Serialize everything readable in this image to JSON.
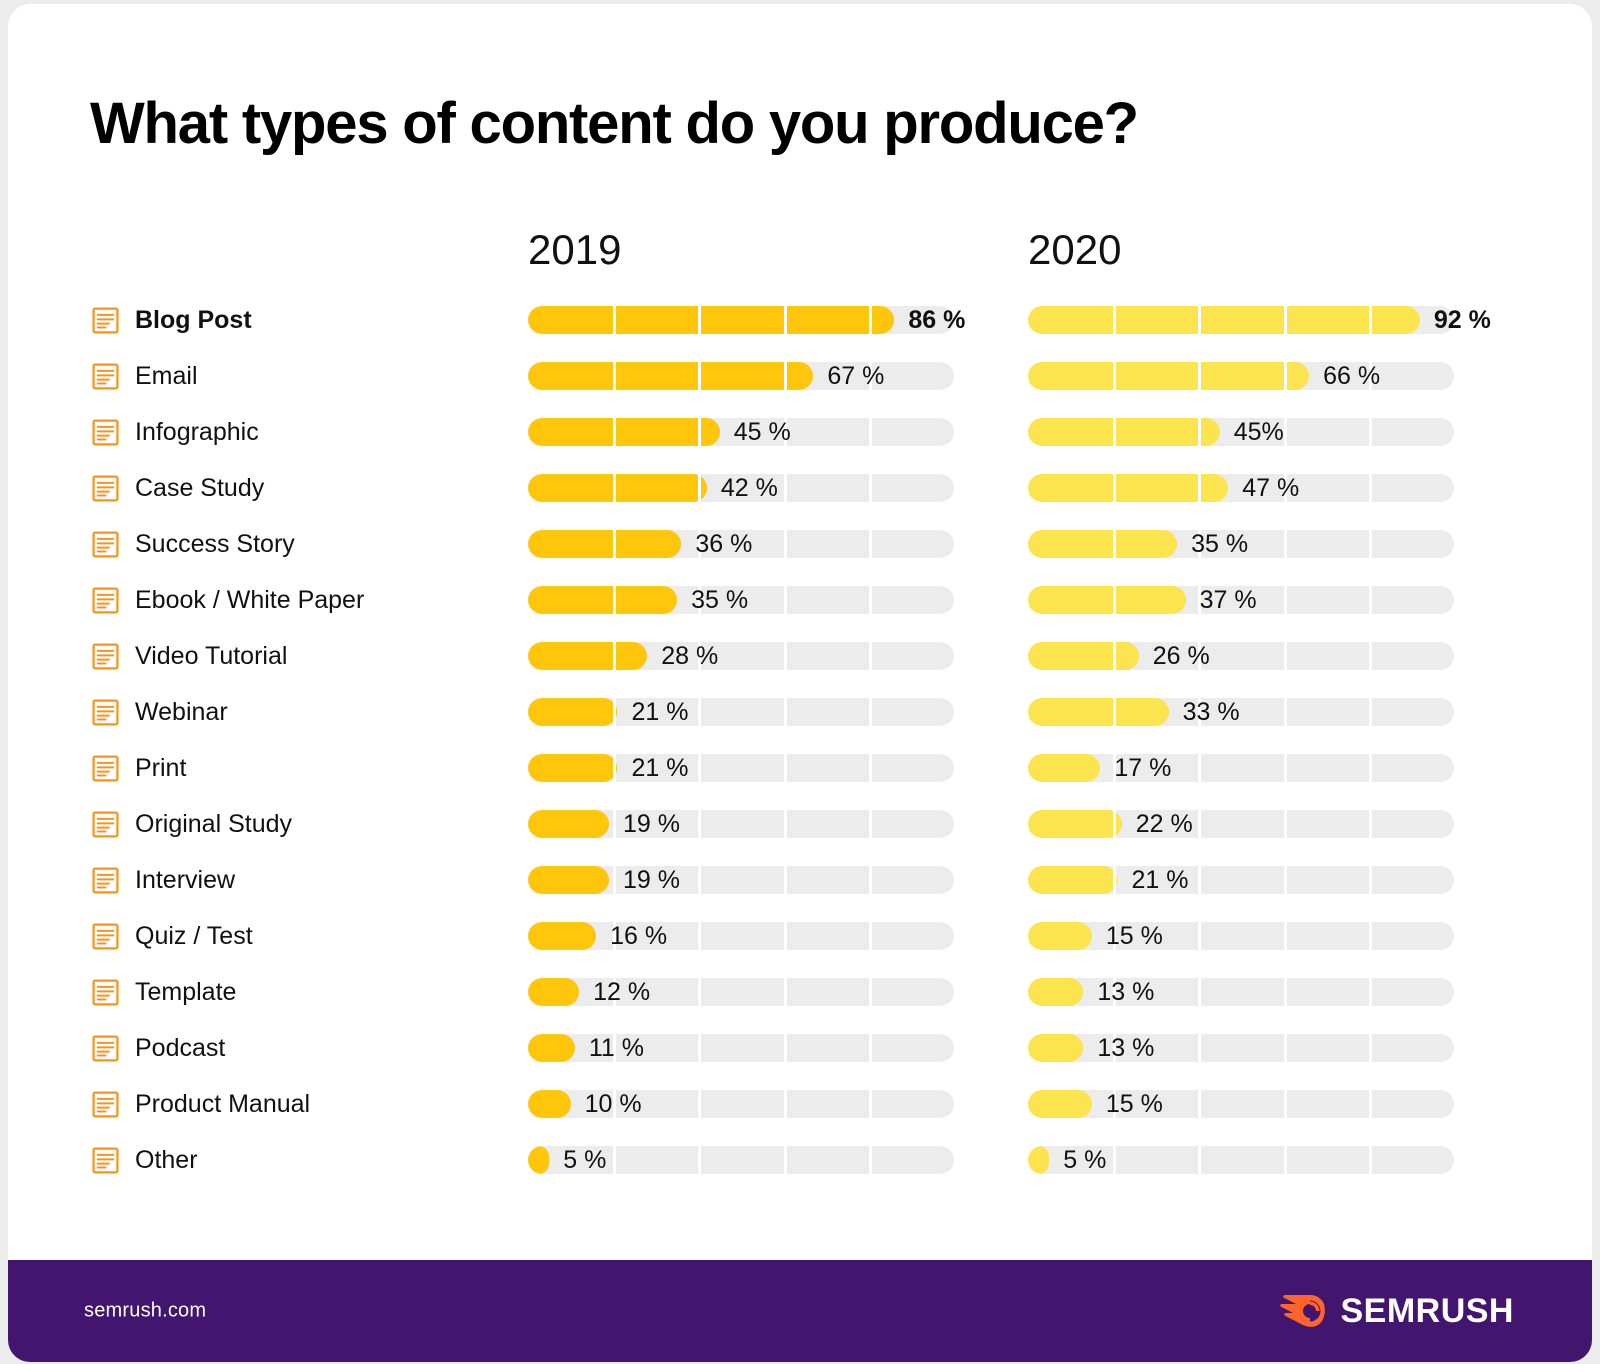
{
  "title": "What types of content do you produce?",
  "colors": {
    "card_background": "#ffffff",
    "page_background": "#ececed",
    "bar_2019": "#FFC60B",
    "bar_2020": "#FBE44D",
    "track": "#ececec",
    "icon_orange": "#F7941D",
    "footer_purple": "#42156f",
    "logo_orange": "#FF642D",
    "text": "#111111"
  },
  "columns": [
    {
      "label": "2019"
    },
    {
      "label": "2020"
    }
  ],
  "icon": "document-icon",
  "footer": {
    "url": "semrush.com",
    "logo_text": "SEMRUSH",
    "logo_mark": "semrush-comet-icon"
  },
  "chart_data": {
    "type": "bar",
    "title": "What types of content do you produce?",
    "xlabel": "",
    "ylabel": "",
    "xlim": [
      0,
      100
    ],
    "unit": "%",
    "orientation": "horizontal",
    "grid": "segmented-5",
    "legend": "column-headers",
    "categories": [
      "Blog Post",
      "Email",
      "Infographic",
      "Case Study",
      "Success Story",
      "Ebook / White Paper",
      "Video Tutorial",
      "Webinar",
      "Print",
      "Original Study",
      "Interview",
      "Quiz / Test",
      "Template",
      "Podcast",
      "Product Manual",
      "Other"
    ],
    "series": [
      {
        "name": "2019",
        "color": "#FFC60B",
        "values": [
          86,
          67,
          45,
          42,
          36,
          35,
          28,
          21,
          21,
          19,
          19,
          16,
          12,
          11,
          10,
          5
        ],
        "labels": [
          "86 %",
          "67 %",
          "45 %",
          "42 %",
          "36 %",
          "35 %",
          "28 %",
          "21 %",
          "21 %",
          "19 %",
          "19 %",
          "16 %",
          "12 %",
          "11 %",
          "10 %",
          "5 %"
        ]
      },
      {
        "name": "2020",
        "color": "#FBE44D",
        "values": [
          92,
          66,
          45,
          47,
          35,
          37,
          26,
          33,
          17,
          22,
          21,
          15,
          13,
          13,
          15,
          5
        ],
        "labels": [
          "92 %",
          "66 %",
          "45%",
          "47 %",
          "35 %",
          "37 %",
          "26 %",
          "33 %",
          "17 %",
          "22 %",
          "21 %",
          "15 %",
          "13 %",
          "13 %",
          "15 %",
          "5 %"
        ]
      }
    ],
    "highlighted_row": "Blog Post"
  }
}
